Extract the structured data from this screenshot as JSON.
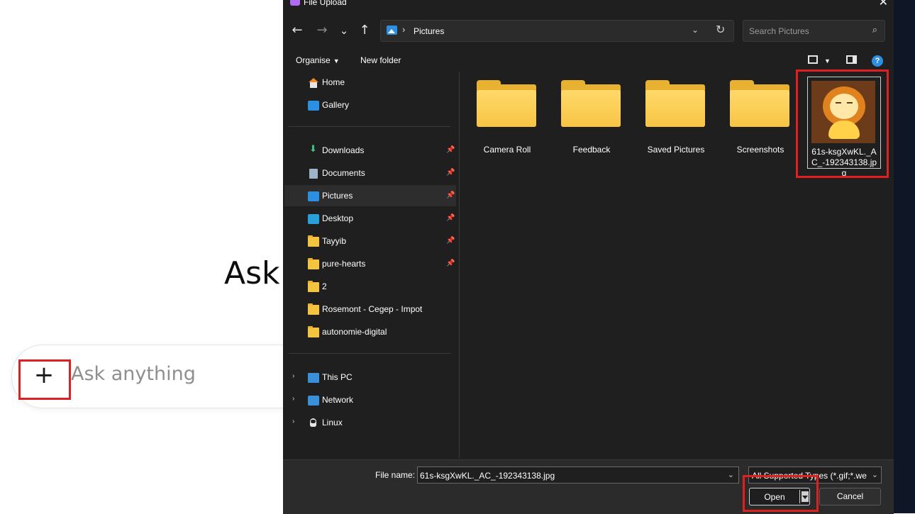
{
  "chat": {
    "heading": "Ask",
    "plus_glyph": "+",
    "input_placeholder": "Ask anything"
  },
  "dialog": {
    "title": "File Upload",
    "close_glyph": "✕",
    "nav": {
      "back": "←",
      "forward": "→",
      "recent": "⌄",
      "up": "↑"
    },
    "address": {
      "separator": "›",
      "location": "Pictures",
      "dropdown": "⌄",
      "refresh": "↻"
    },
    "search_placeholder": "Search Pictures",
    "search_glyph": "⌕",
    "toolbar": {
      "organise": "Organise",
      "organise_caret": "▼",
      "new_folder": "New folder",
      "view_caret": "▼",
      "help": "?"
    },
    "sidebar": {
      "quick": [
        {
          "label": "Home",
          "icon": "home-icon"
        },
        {
          "label": "Gallery",
          "icon": "gallery-icon"
        }
      ],
      "pinned": [
        {
          "label": "Downloads",
          "icon": "downloads-icon",
          "pinned": true
        },
        {
          "label": "Documents",
          "icon": "documents-icon",
          "pinned": true
        },
        {
          "label": "Pictures",
          "icon": "pictures-icon",
          "pinned": true,
          "selected": true
        },
        {
          "label": "Desktop",
          "icon": "desktop-icon",
          "pinned": true
        },
        {
          "label": "Tayyib",
          "icon": "folder-icon",
          "pinned": true
        },
        {
          "label": "pure-hearts",
          "icon": "folder-icon",
          "pinned": true
        },
        {
          "label": "2",
          "icon": "folder-icon",
          "pinned": false
        },
        {
          "label": "Rosemont - Cegep - Impot",
          "icon": "folder-icon",
          "pinned": false
        },
        {
          "label": "autonomie-digital",
          "icon": "folder-icon",
          "pinned": false
        }
      ],
      "locations": [
        {
          "label": "This PC",
          "icon": "this-pc-icon"
        },
        {
          "label": "Network",
          "icon": "network-icon"
        },
        {
          "label": "Linux",
          "icon": "linux-icon"
        }
      ],
      "pin_glyph": "📌",
      "expand_glyph": "›"
    },
    "folders": [
      "Camera Roll",
      "Feedback",
      "Saved Pictures",
      "Screenshots"
    ],
    "selected_file": "61s-ksgXwKL._AC_-192343138.jpg",
    "bottom": {
      "file_name_label": "File name:",
      "file_name_value": "61s-ksgXwKL._AC_-192343138.jpg",
      "dd_glyph": "⌄",
      "file_type": "All Supported Types (*.gif;*.webp;*.png;*.jpg)",
      "open": "Open",
      "cancel": "Cancel"
    }
  },
  "colors": {
    "annotation": "#e02020",
    "dialog_bg": "#1f1f1f",
    "accent_blue": "#2d8fe0",
    "folder_yellow": "#f7c444"
  }
}
